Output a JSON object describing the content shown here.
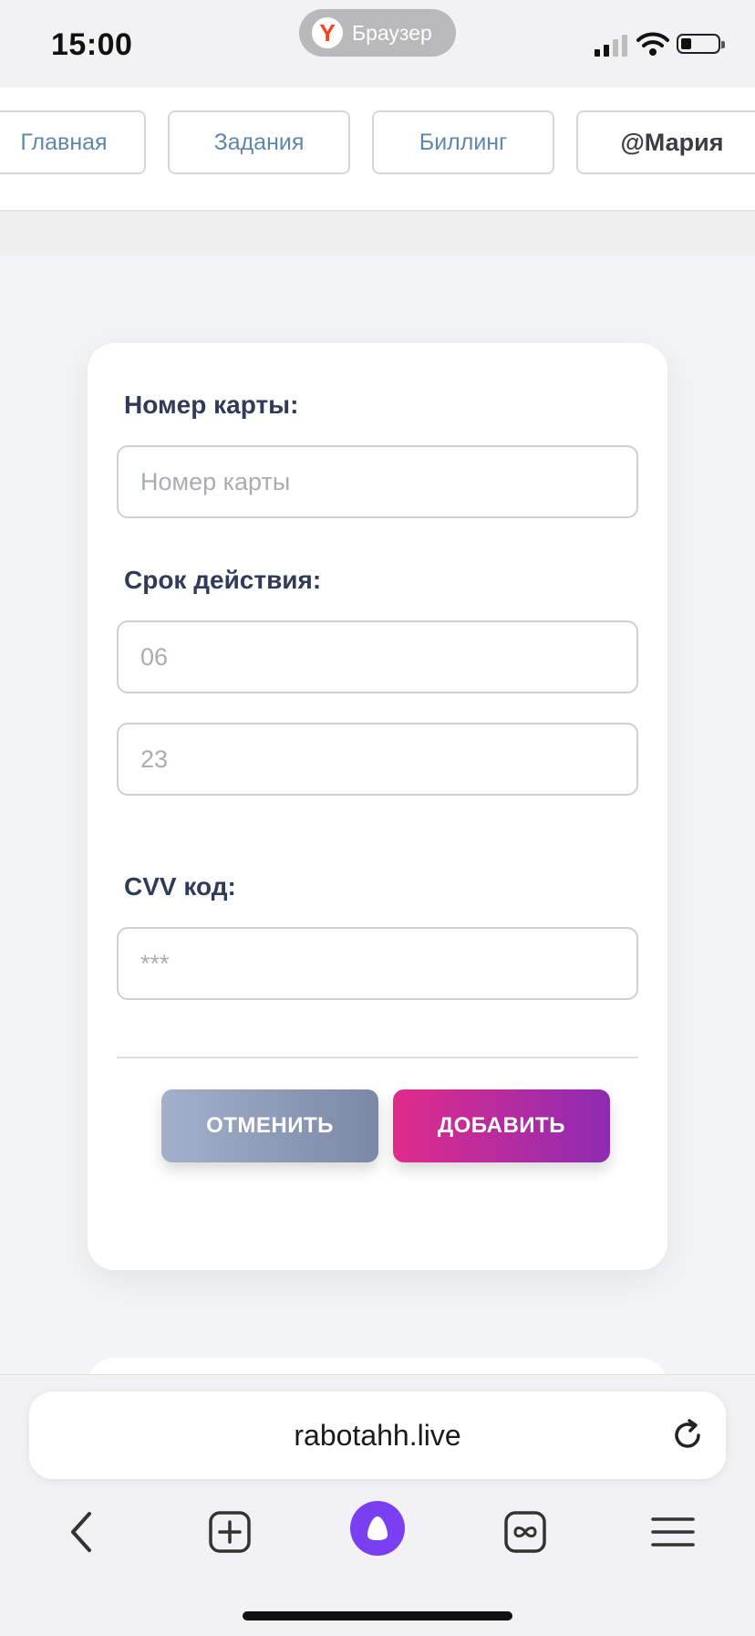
{
  "status_bar": {
    "time": "15:00",
    "browser_label": "Браузер"
  },
  "nav": {
    "tabs": [
      {
        "label": "Главная"
      },
      {
        "label": "Задания"
      },
      {
        "label": "Биллинг"
      },
      {
        "label": "@Мария"
      }
    ]
  },
  "form": {
    "card_number_label": "Номер карты:",
    "card_number_placeholder": "Номер карты",
    "expiry_label": "Срок действия:",
    "expiry_month_placeholder": "06",
    "expiry_year_placeholder": "23",
    "cvv_label": "CVV код:",
    "cvv_placeholder": "***",
    "cancel_label": "ОТМЕНИТЬ",
    "add_label": "ДОБАВИТЬ"
  },
  "browser": {
    "url": "rabotahh.live",
    "icons": [
      "back-icon",
      "new-tab-icon",
      "alice-icon",
      "tabs-icon",
      "menu-icon",
      "reload-icon"
    ]
  },
  "colors": {
    "accent_pink": "#e02b8a",
    "accent_purple": "#8e2bb3",
    "label_navy": "#2f3b58",
    "nav_link": "#5f86ad"
  }
}
